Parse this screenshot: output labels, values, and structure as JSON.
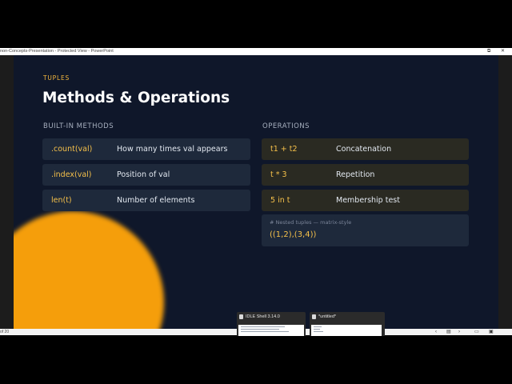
{
  "window": {
    "title": "non-Concepts-Presentation  -  Protected View - PowerPoint"
  },
  "slide": {
    "eyebrow": "TUPLES",
    "title": "Methods & Operations",
    "builtin_heading": "BUILT-IN METHODS",
    "operations_heading": "OPERATIONS",
    "methods": [
      {
        "code": ".count(val)",
        "desc": "How many times val appears"
      },
      {
        "code": ".index(val)",
        "desc": "Position of val"
      },
      {
        "code": "len(t)",
        "desc": "Number of elements"
      }
    ],
    "operations": [
      {
        "code": "t1 + t2",
        "desc": "Concatenation"
      },
      {
        "code": "t * 3",
        "desc": "Repetition"
      },
      {
        "code": "5 in t",
        "desc": "Membership test"
      }
    ],
    "code_box": {
      "comment": "# Nested tuples — matrix-style",
      "expr": "((1,2),(3,4))"
    },
    "colors": {
      "background": "#0f172a",
      "accent": "#f5c04a",
      "blob": "#f59e0b"
    }
  },
  "statusbar": {
    "page_text": "of 20"
  },
  "taskbar_previews": [
    {
      "title": "IDLE Shell 3.14.0"
    },
    {
      "title": "*untitled*"
    }
  ]
}
